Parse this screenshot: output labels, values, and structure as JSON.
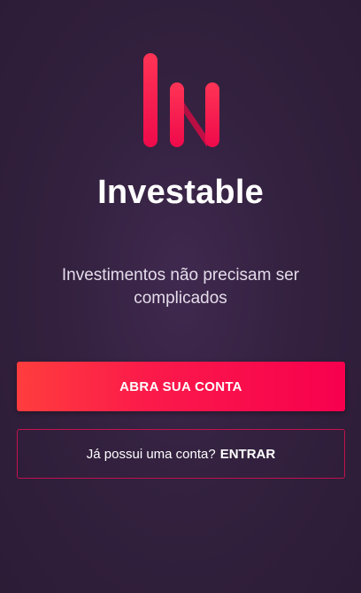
{
  "app": {
    "name": "Investable",
    "tagline": "Investimentos não precisam ser complicados"
  },
  "actions": {
    "primary_label": "ABRA SUA CONTA",
    "secondary_prompt": "Já possui uma conta?",
    "secondary_label": "ENTRAR"
  },
  "icons": {
    "logo": "investable-logo-icon"
  },
  "colors": {
    "background": "#33213f",
    "accent_start": "#ff3d3d",
    "accent_end": "#f7004e",
    "outline": "#c1124c"
  }
}
